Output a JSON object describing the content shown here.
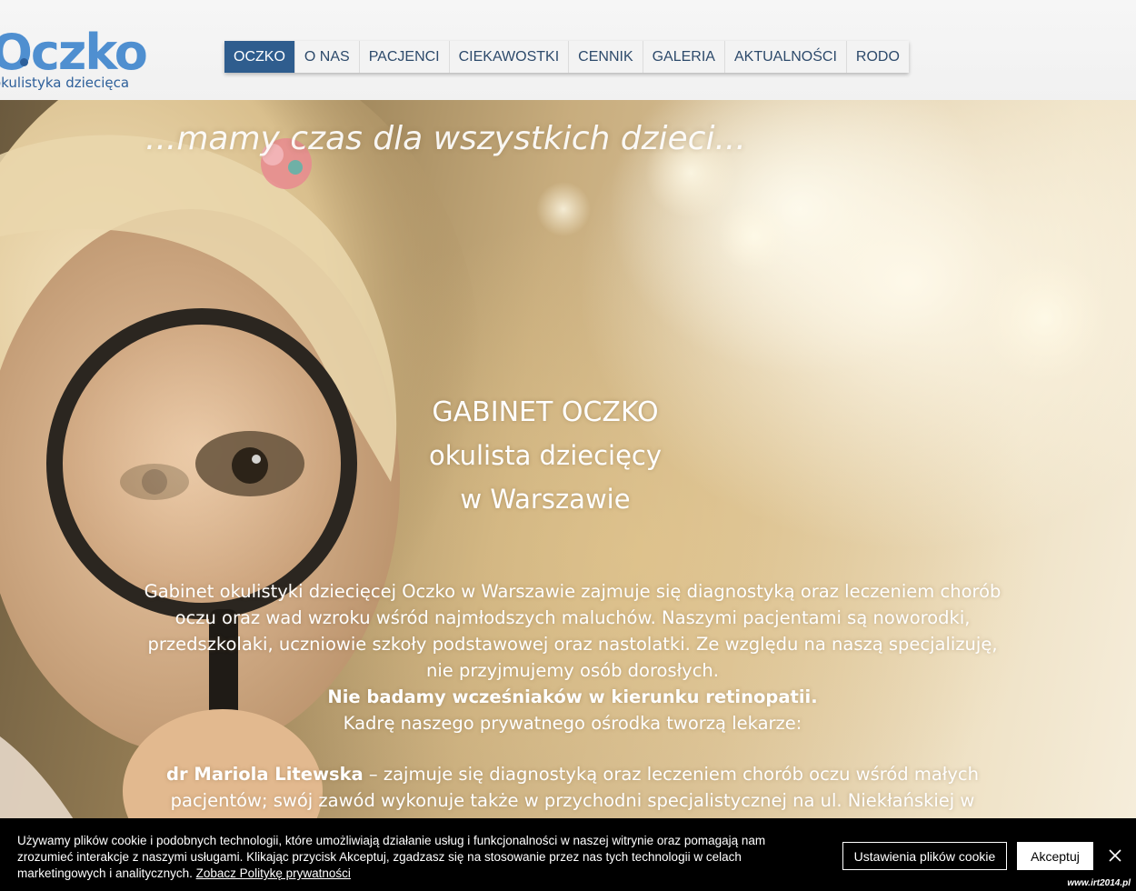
{
  "header": {
    "logo": {
      "wordmark": "Oczko",
      "subtitle": "okulistyka dziecięca"
    },
    "nav": [
      {
        "label": "OCZKO",
        "active": true
      },
      {
        "label": "O NAS"
      },
      {
        "label": "PACJENCI"
      },
      {
        "label": "CIEKAWOSTKI"
      },
      {
        "label": "CENNIK"
      },
      {
        "label": "GALERIA"
      },
      {
        "label": "AKTUALNOŚCI"
      },
      {
        "label": "RODO"
      }
    ]
  },
  "hero": {
    "tagline": "...mamy czas dla wszystkich dzieci...",
    "headline_1": "GABINET OCZKO",
    "headline_2": "okulista dziecięcy",
    "headline_3": "w Warszawie",
    "intro": "Gabinet okulistyki dziecięcej Oczko w Warszawie zajmuje się diagnostyką oraz leczeniem chorób oczu oraz wad wzroku wśród najmłodszych maluchów. Naszymi pacjentami są noworodki, przedszkolaki, uczniowie szkoły podstawowej oraz nastolatki. Ze względu na naszą specjalizuję, nie przyjmujemy osób dorosłych.",
    "intro_bold": "Nie badamy wcześniaków w kierunku retinopatii.",
    "intro_staff": "Kadrę naszego prywatnego ośrodka tworzą lekarze:",
    "doctor_name": "dr Mariola Litewska",
    "doctor_desc": " – zajmuje się diagnostyką oraz leczeniem chorób oczu wśród małych pacjentów; swój zawód wykonuje także w przychodni specjalistycznej na ul. Niekłańskiej w"
  },
  "cookie_bar": {
    "text": "Używamy plików cookie i podobnych technologii, które umożliwiają działanie usług i funkcjonalności w naszej witrynie oraz pomagają nam zrozumieć interakcje z naszymi usługami. Klikając przycisk Akceptuj, zgadzasz się na stosowanie przez nas tych technologii w celach marketingowych i analitycznych.",
    "policy_link": "Zobacz Politykę prywatności",
    "settings_button": "Ustawienia plików cookie",
    "accept_button": "Akceptuj",
    "close_icon": "close-icon"
  },
  "watermark": "www.irt2014.pl"
}
